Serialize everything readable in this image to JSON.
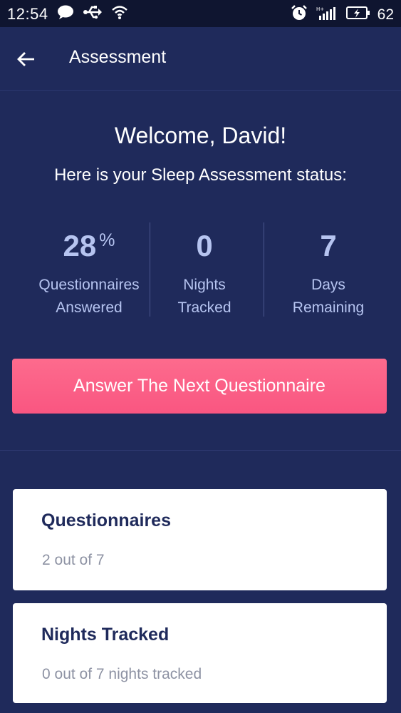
{
  "status_bar": {
    "time": "12:54",
    "battery": "62",
    "icons_left": [
      "chat-icon",
      "usb-icon",
      "wifi-icon"
    ],
    "icons_right": [
      "alarm-icon",
      "signal-icon",
      "battery-icon"
    ]
  },
  "app_bar": {
    "title": "Assessment",
    "back_icon": "back-arrow-icon"
  },
  "welcome": {
    "title": "Welcome, David!",
    "subtitle": "Here is your Sleep Assessment status:"
  },
  "stats": [
    {
      "value": "28",
      "unit": "%",
      "label_line1": "Questionnaires",
      "label_line2": "Answered"
    },
    {
      "value": "0",
      "label_line1": "Nights",
      "label_line2": "Tracked"
    },
    {
      "value": "7",
      "label_line1": "Days",
      "label_line2": "Remaining"
    }
  ],
  "cta": {
    "label": "Answer The Next Questionnaire"
  },
  "cards": [
    {
      "title": "Questionnaires",
      "subtitle": "2 out of 7"
    },
    {
      "title": "Nights Tracked",
      "subtitle": "0 out of 7 nights tracked"
    }
  ],
  "colors": {
    "background": "#1f2a5b",
    "status_bar": "#0f1530",
    "accent": "#f95681",
    "stat_text": "#b6c4f0",
    "card_title": "#1f2a5b",
    "card_subtitle": "#8d92a3"
  }
}
